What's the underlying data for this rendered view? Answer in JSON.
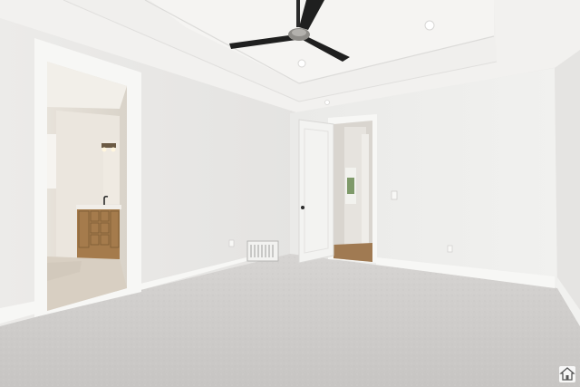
{
  "photo": {
    "subject": "empty-bedroom-interior",
    "colors": {
      "wall": "#eeeeec",
      "ceiling": "#f2f1ef",
      "carpet": "#cfcdcb",
      "trim": "#f6f6f4",
      "fan": "#1f1f1f",
      "cabinet": "#a57b4c",
      "floor_wood": "#a07a52"
    },
    "icons": [
      "ceiling-fan-icon",
      "recessed-light-icon",
      "home-logo-icon"
    ]
  },
  "watermark": {
    "icon": "home-logo-icon"
  }
}
